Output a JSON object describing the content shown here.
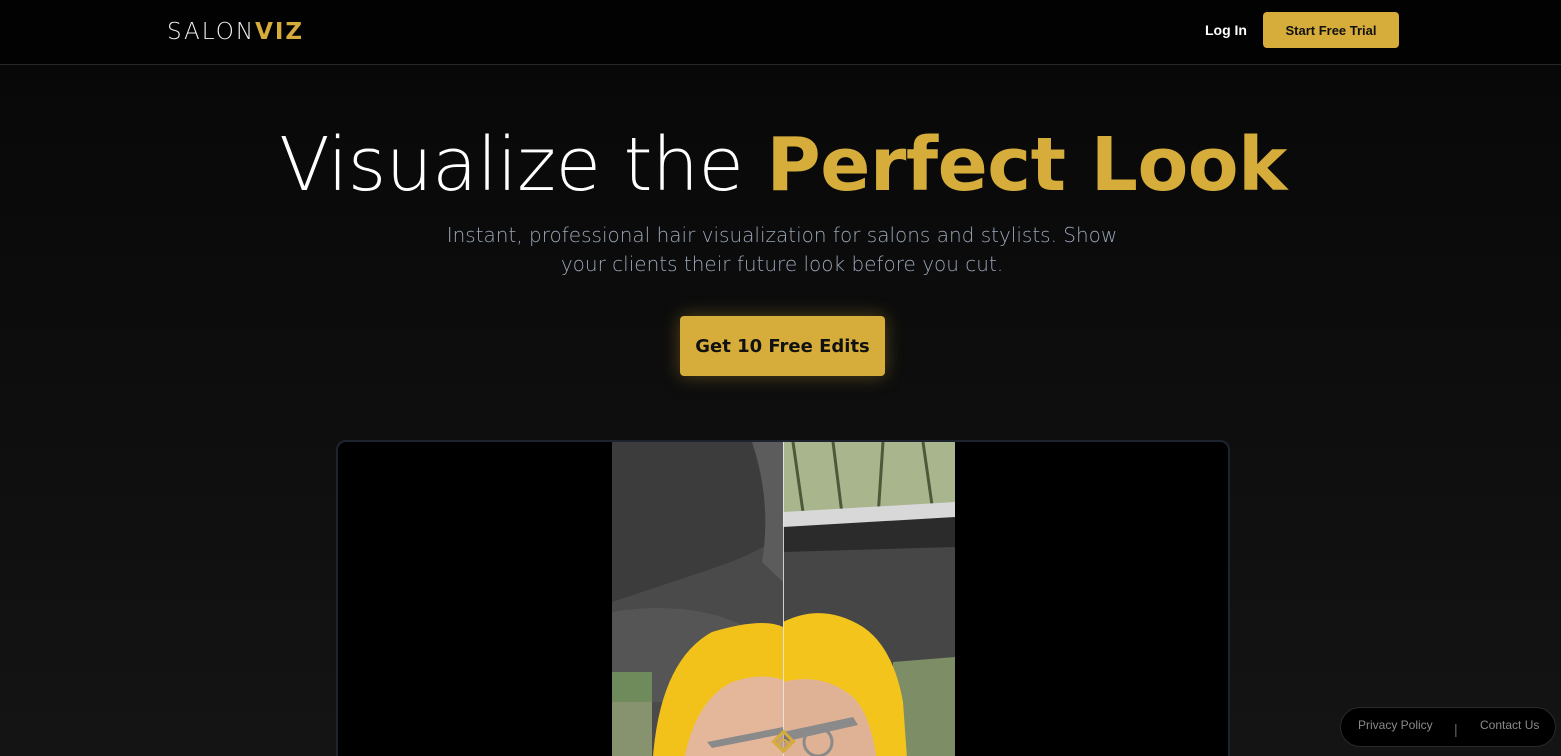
{
  "header": {
    "logo_main": "SALON",
    "logo_accent": "VIZ",
    "login_label": "Log In",
    "trial_label": "Start Free Trial"
  },
  "hero": {
    "title_plain": "Visualize the",
    "title_accent": "Perfect Look",
    "subtitle": "Instant, professional hair visualization for salons and stylists. Show your clients their future look before you cut.",
    "cta_label": "Get 10 Free Edits"
  },
  "comparison": {
    "divider_position_fraction": 0.5
  },
  "footer": {
    "privacy_label": "Privacy Policy",
    "separator": "|",
    "contact_label": "Contact Us"
  },
  "colors": {
    "accent": "#d6ad3a",
    "background": "#0c0c0c",
    "header_bg": "#020202",
    "subtitle_text": "#9aa6b8"
  }
}
